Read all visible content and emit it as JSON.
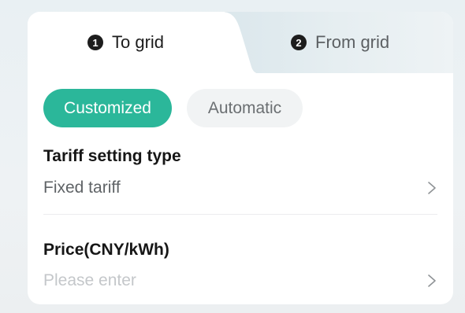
{
  "tabs": [
    {
      "number": "1",
      "label": "To grid",
      "active": true
    },
    {
      "number": "2",
      "label": "From grid",
      "active": false
    }
  ],
  "mode_toggle": {
    "options": [
      "Customized",
      "Automatic"
    ],
    "selected": "Customized"
  },
  "tariff_setting": {
    "label": "Tariff setting type",
    "value": "Fixed tariff"
  },
  "price": {
    "label": "Price(CNY/kWh)",
    "placeholder": "Please enter"
  },
  "colors": {
    "accent": "#2bb79a",
    "inactive_pill": "#f1f3f4",
    "text_primary": "#161616",
    "text_secondary": "#5f6366",
    "placeholder": "#c4c7ca"
  },
  "icons": {
    "row_arrow": "chevron-right-icon"
  }
}
